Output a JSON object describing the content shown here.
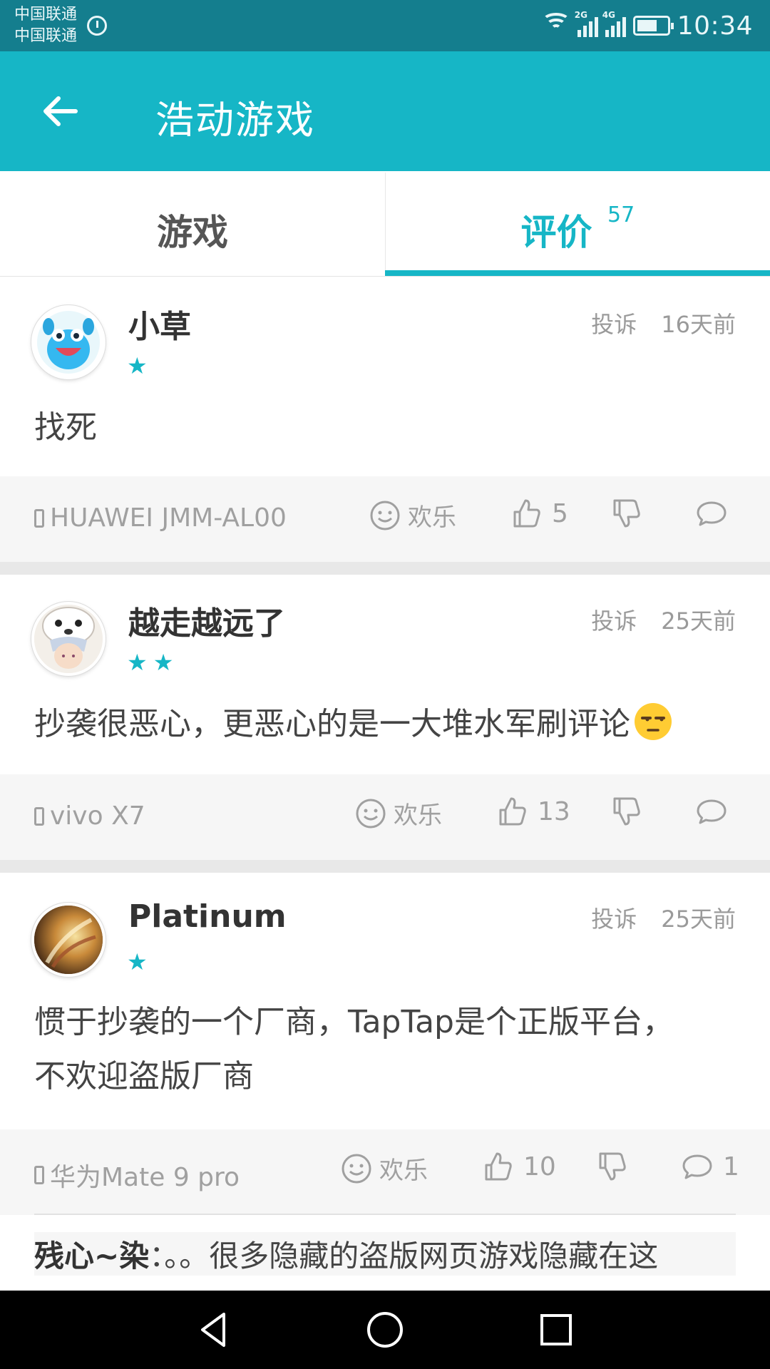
{
  "status_bar": {
    "carrier_1": "中国联通",
    "carrier_2": "中国联通",
    "net_a": "2G",
    "net_b": "4G",
    "time": "10:34"
  },
  "app_bar": {
    "title": "浩动游戏",
    "back_icon": "arrow-left-icon"
  },
  "tabs": [
    {
      "label": "游戏",
      "active": false
    },
    {
      "label": "评价",
      "active": true,
      "count": "57"
    }
  ],
  "reviews": [
    {
      "author": "小草",
      "stars": 1,
      "report_label": "投诉",
      "time": "16天前",
      "text": "找死",
      "device": "HUAWEI JMM-AL00",
      "mood": "欢乐",
      "likes": "5",
      "comments": ""
    },
    {
      "author": "越走越远了",
      "stars": 2,
      "report_label": "投诉",
      "time": "25天前",
      "text": "抄袭很恶心，更恶心的是一大堆水军刷评论",
      "device": "vivo X7",
      "mood": "欢乐",
      "likes": "13",
      "comments": ""
    },
    {
      "author": "Platinum",
      "stars": 1,
      "report_label": "投诉",
      "time": "25天前",
      "text_line1": "惯于抄袭的一个厂商，TapTap是个正版平台，",
      "text_line2": "不欢迎盗版厂商",
      "device": "华为Mate 9 pro",
      "mood": "欢乐",
      "likes": "10",
      "comments": "1"
    }
  ],
  "reply_preview": {
    "author": "残心~染",
    "separator": "：",
    "text": "。。很多隐藏的盗版网页游戏隐藏在这"
  },
  "colors": {
    "accent": "#16b6c6",
    "status_bar": "#147e8e"
  }
}
